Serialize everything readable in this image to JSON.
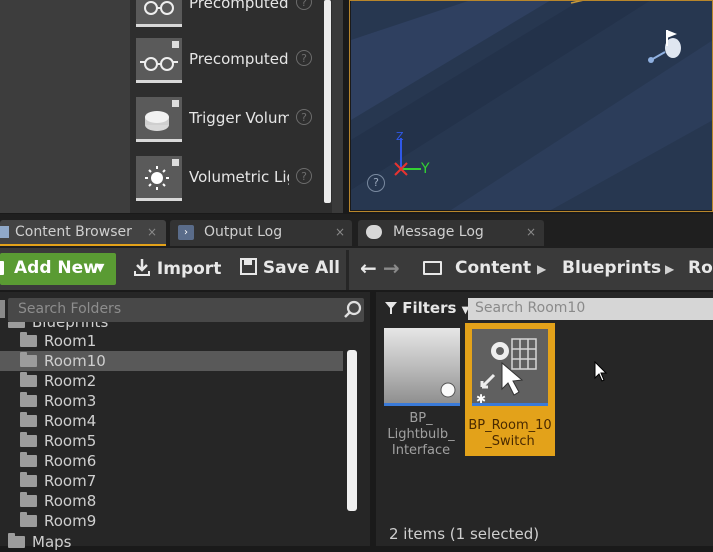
{
  "place_actors": {
    "items": [
      {
        "label": "Precomputed",
        "icon": "glasses-icon"
      },
      {
        "label": "Precomputed",
        "icon": "glasses-icon"
      },
      {
        "label": "Trigger Volum",
        "icon": "trigger-volume-icon"
      },
      {
        "label": "Volumetric Lightr",
        "icon": "light-icon"
      }
    ],
    "help_glyph": "?"
  },
  "viewport": {
    "axis_y": "Y",
    "axis_z": "Z",
    "help_glyph": "?"
  },
  "tabs": [
    {
      "label": "Content Browser",
      "close": "×",
      "active": true
    },
    {
      "label": "Output Log",
      "close": "×",
      "active": false
    },
    {
      "label": "Message Log",
      "close": "×",
      "active": false
    }
  ],
  "toolbar": {
    "add_new": "Add New",
    "add_new_caret": "▼",
    "import": "Import",
    "save_all": "Save All",
    "back": "←",
    "forward": "→"
  },
  "breadcrumb": [
    "Content",
    "Blueprints",
    "Roo"
  ],
  "folders": {
    "search_placeholder": "Search Folders",
    "parent_partial": "Blueprints",
    "items": [
      "Room1",
      "Room10",
      "Room2",
      "Room3",
      "Room4",
      "Room5",
      "Room6",
      "Room7",
      "Room8",
      "Room9"
    ],
    "selected": "Room10",
    "next_root": "Maps"
  },
  "assets": {
    "filters_label": "Filters",
    "search_placeholder": "Search Room10",
    "items": [
      {
        "label": "BP_ Lightbulb_ Interface",
        "selected": false
      },
      {
        "label": "BP_Room_10 _Switch",
        "selected": true
      }
    ],
    "status": "2 items (1 selected)"
  },
  "colors": {
    "accent": "#e3a21a",
    "add_new_green": "#5a9b33",
    "selection_gray": "#595959"
  }
}
